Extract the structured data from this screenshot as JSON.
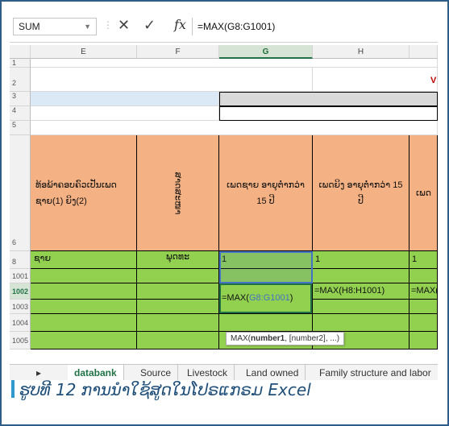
{
  "formula_bar": {
    "name_box": "SUM",
    "cancel_glyph": "✕",
    "enter_glyph": "✓",
    "fx_label": "fx",
    "formula": "=MAX(G8:G1001)"
  },
  "columns": [
    "E",
    "F",
    "G",
    "H"
  ],
  "rows": [
    "1",
    "2",
    "3",
    "4",
    "5",
    "6",
    "8",
    "1001",
    "1002",
    "1003",
    "1004",
    "1005"
  ],
  "header_cells": {
    "E": "ທ້ອພ້າຄອບຄົວເປັນເພດ ຊາຍ(1) ຍິງ(2)",
    "F": "ສາດສະໜາ",
    "G": "ເພດຊາຍ ອາຍຸຕ່ຳກວ່າ 15 ປີ",
    "H": "ເພດຍິງ ອາຍຸຕ່ຳກວ່າ 15 ປີ",
    "I": "ເພດ"
  },
  "row8": {
    "E": "ຊາຍ",
    "F": "ພຸດທະ",
    "G": "1",
    "H": "1",
    "I": "1"
  },
  "row1002": {
    "G": "=MAX(G8:G1001)",
    "H": "=MAX(H8:H1001)",
    "I": "=MAX("
  },
  "row2_fragment": "VI",
  "formula_parts": {
    "prefix": "=MAX(",
    "range": "G8:G1001",
    "suffix": ")"
  },
  "tooltip": {
    "fn": "MAX(",
    "arg1": "number1",
    "rest": ", [number2], ...)"
  },
  "sheet_tabs": [
    "databank",
    "Source",
    "Livestock",
    "Land owned",
    "Family structure and labor"
  ],
  "active_tab": "databank",
  "nav_arrow": "▸",
  "caption": "ຮູບທີ 12 ການນຳໃຊ້ສູດໃນໂປຣແກຣມ Excel",
  "colors": {
    "peach": "#f4b183",
    "green": "#92d050",
    "excel_green": "#217346",
    "frame": "#2f5d8a",
    "caption": "#1f4e79"
  }
}
